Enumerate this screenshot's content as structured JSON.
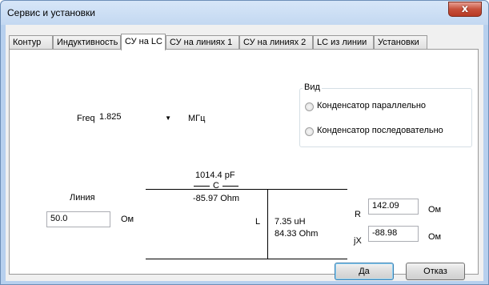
{
  "window": {
    "title": "Сервис и установки",
    "close_glyph": "x"
  },
  "tabs": [
    {
      "label": "Контур"
    },
    {
      "label": "Индуктивность"
    },
    {
      "label": "СУ на LC"
    },
    {
      "label": "СУ на линиях 1"
    },
    {
      "label": "СУ на линиях 2"
    },
    {
      "label": "LC из линии"
    },
    {
      "label": "Установки"
    }
  ],
  "active_tab": "СУ на LC",
  "freq": {
    "label": "Freq",
    "value": "1.825",
    "unit": "МГц",
    "arrow": "▼"
  },
  "view_group": {
    "title": "Вид",
    "options": [
      {
        "label": "Конденсатор параллельно"
      },
      {
        "label": "Конденсатор последовательно"
      }
    ]
  },
  "line": {
    "label": "Линия",
    "value": "50.0",
    "unit": "Ом"
  },
  "capacitor": {
    "value": "1014.4 pF",
    "name": "C",
    "reactance": "-85.97 Ohm"
  },
  "inductor": {
    "name": "L",
    "value": "7.35 uH",
    "reactance": "84.33 Ohm"
  },
  "load": {
    "r_label": "R",
    "r_value": "142.09",
    "r_unit": "Ом",
    "x_label": "jX",
    "x_value": "-88.98",
    "x_unit": "Ом"
  },
  "buttons": {
    "ok": "Да",
    "cancel": "Отказ"
  }
}
